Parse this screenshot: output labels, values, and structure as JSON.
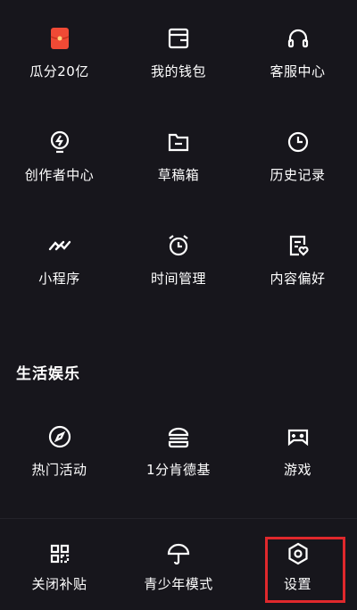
{
  "grid_top": [
    {
      "label": "瓜分20亿",
      "icon": "red-envelope-icon"
    },
    {
      "label": "我的钱包",
      "icon": "wallet-icon"
    },
    {
      "label": "客服中心",
      "icon": "headset-icon"
    },
    {
      "label": "创作者中心",
      "icon": "lightbulb-icon"
    },
    {
      "label": "草稿箱",
      "icon": "folder-icon"
    },
    {
      "label": "历史记录",
      "icon": "clock-icon"
    },
    {
      "label": "小程序",
      "icon": "mini-program-icon"
    },
    {
      "label": "时间管理",
      "icon": "alarm-clock-icon"
    },
    {
      "label": "内容偏好",
      "icon": "heart-document-icon"
    }
  ],
  "section": {
    "title": "生活娱乐"
  },
  "grid_life": [
    {
      "label": "热门活动",
      "icon": "compass-icon"
    },
    {
      "label": "1分肯德基",
      "icon": "burger-icon"
    },
    {
      "label": "游戏",
      "icon": "gamepad-icon"
    }
  ],
  "bottom_bar": [
    {
      "label": "关闭补贴",
      "icon": "grid-icon"
    },
    {
      "label": "青少年模式",
      "icon": "umbrella-icon"
    },
    {
      "label": "设置",
      "icon": "hexagon-gear-icon"
    }
  ],
  "colors": {
    "background": "#17161c",
    "text": "#ffffff",
    "accent_red": "#f04a35",
    "highlight_border": "#e0282c"
  }
}
